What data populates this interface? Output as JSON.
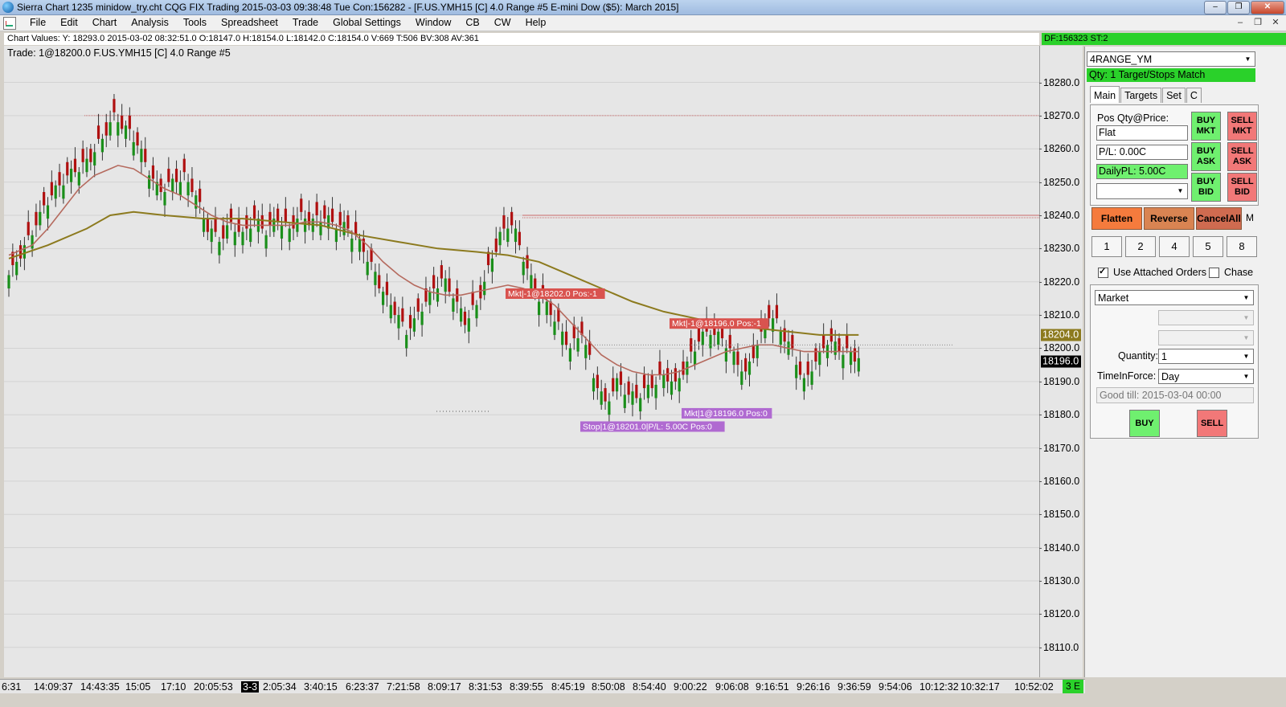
{
  "window": {
    "title": "Sierra Chart 1235 minidow_try.cht  CQG FIX Trading 2015-03-03  09:38:48 Tue   Con:156282 - [F.US.YMH15 [C]  4.0 Range  #5   E-mini Dow ($5): March 2015]",
    "minimize_glyph": "–",
    "restore_glyph": "❐",
    "close_glyph": "✕"
  },
  "menu": {
    "items": [
      "File",
      "Edit",
      "Chart",
      "Analysis",
      "Tools",
      "Spreadsheet",
      "Trade",
      "Global Settings",
      "Window",
      "CB",
      "CW",
      "Help"
    ],
    "mdi_minimize": "–",
    "mdi_restore": "❐",
    "mdi_close": "✕"
  },
  "chart": {
    "values_line": "Chart Values: Y: 18293.0  2015-03-02  08:32:51.0  O:18147.0  H:18154.0  L:18142.0  C:18154.0  V:669  T:506  BV:308  AV:361",
    "df_status": "DF:156323  ST:2",
    "trade_label": "Trade:  1@18200.0   F.US.YMH15 [C]  4.0 Range  #5",
    "current_price_badge": "18196.0",
    "ma_price_badge": "18204.0",
    "time_end_badge": "3 E",
    "colors": {
      "background": "#e6e6e6",
      "up_candle": "#1a8f1a",
      "down_candle": "#b01010",
      "ma_fast": "#b56a5e",
      "ma_slow": "#8c7a1e",
      "resistance": "#c96b6b",
      "sell_marker": "#d9534f",
      "buy_marker": "#b06ad1"
    },
    "annotations": {
      "sell1": "Mkt|-1@18202.0 Pos:-1",
      "sell2": "Mkt|-1@18196.0 Pos:-1",
      "buy1": "Mkt|1@18196.0 Pos:0",
      "stop1": "Stop|1@18201.0|P/L: 5.00C Pos:0"
    }
  },
  "chart_data": {
    "type": "candlestick",
    "title": "F.US.YMH15 [C] 4.0 Range #5",
    "ylim": [
      18101,
      18291
    ],
    "y_ticks": [
      18110,
      18120,
      18130,
      18140,
      18150,
      18160,
      18170,
      18180,
      18190,
      18200,
      18210,
      18220,
      18230,
      18240,
      18250,
      18260,
      18270,
      18280
    ],
    "x_labels": [
      "6:31",
      "14:09:37",
      "14:43:35",
      "15:05",
      "17:10",
      "20:05:53",
      "3-3",
      "2:05:34",
      "3:40:15",
      "6:23:37",
      "7:21:58",
      "8:09:17",
      "8:31:53",
      "8:39:55",
      "8:45:19",
      "8:50:08",
      "8:54:40",
      "9:00:22",
      "9:06:08",
      "9:16:51",
      "9:26:16",
      "9:36:59",
      "9:54:06",
      "10:12:32",
      "10:32:17",
      "10:52:02"
    ],
    "close_path": [
      [
        0,
        18222
      ],
      [
        4,
        18230
      ],
      [
        8,
        18240
      ],
      [
        12,
        18248
      ],
      [
        16,
        18253
      ],
      [
        20,
        18256
      ],
      [
        24,
        18263
      ],
      [
        27,
        18270
      ],
      [
        30,
        18266
      ],
      [
        33,
        18262
      ],
      [
        36,
        18253
      ],
      [
        39,
        18247
      ],
      [
        42,
        18250
      ],
      [
        45,
        18252
      ],
      [
        48,
        18246
      ],
      [
        51,
        18236
      ],
      [
        54,
        18233
      ],
      [
        57,
        18237
      ],
      [
        60,
        18234
      ],
      [
        63,
        18239
      ],
      [
        66,
        18235
      ],
      [
        69,
        18239
      ],
      [
        72,
        18236
      ],
      [
        75,
        18240
      ],
      [
        78,
        18238
      ],
      [
        81,
        18240
      ],
      [
        84,
        18237
      ],
      [
        87,
        18236
      ],
      [
        90,
        18232
      ],
      [
        93,
        18225
      ],
      [
        96,
        18217
      ],
      [
        99,
        18211
      ],
      [
        102,
        18205
      ],
      [
        105,
        18210
      ],
      [
        108,
        18216
      ],
      [
        111,
        18221
      ],
      [
        114,
        18216
      ],
      [
        117,
        18208
      ],
      [
        120,
        18213
      ],
      [
        123,
        18224
      ],
      [
        126,
        18234
      ],
      [
        129,
        18238
      ],
      [
        132,
        18227
      ],
      [
        135,
        18217
      ],
      [
        138,
        18213
      ],
      [
        141,
        18207
      ],
      [
        144,
        18200
      ],
      [
        147,
        18205
      ],
      [
        150,
        18192
      ],
      [
        153,
        18183
      ],
      [
        156,
        18190
      ],
      [
        159,
        18186
      ],
      [
        162,
        18186
      ],
      [
        165,
        18189
      ],
      [
        168,
        18192
      ],
      [
        171,
        18189
      ],
      [
        174,
        18195
      ],
      [
        177,
        18203
      ],
      [
        180,
        18205
      ],
      [
        183,
        18203
      ],
      [
        186,
        18198
      ],
      [
        189,
        18192
      ],
      [
        192,
        18201
      ],
      [
        195,
        18210
      ],
      [
        198,
        18206
      ],
      [
        201,
        18199
      ],
      [
        204,
        18190
      ],
      [
        207,
        18196
      ],
      [
        210,
        18202
      ],
      [
        213,
        18200
      ],
      [
        216,
        18198
      ],
      [
        218,
        18197
      ]
    ],
    "ma_fast": [
      [
        0,
        18228
      ],
      [
        6,
        18231
      ],
      [
        10,
        18236
      ],
      [
        14,
        18242
      ],
      [
        18,
        18248
      ],
      [
        22,
        18252
      ],
      [
        26,
        18254
      ],
      [
        28,
        18255
      ],
      [
        32,
        18254
      ],
      [
        36,
        18251
      ],
      [
        40,
        18248
      ],
      [
        44,
        18246
      ],
      [
        48,
        18243
      ],
      [
        52,
        18240
      ],
      [
        56,
        18238
      ],
      [
        60,
        18237
      ],
      [
        64,
        18237
      ],
      [
        68,
        18237
      ],
      [
        72,
        18237
      ],
      [
        76,
        18238
      ],
      [
        80,
        18238
      ],
      [
        84,
        18237
      ],
      [
        88,
        18235
      ],
      [
        92,
        18231
      ],
      [
        96,
        18226
      ],
      [
        100,
        18222
      ],
      [
        104,
        18219
      ],
      [
        108,
        18217
      ],
      [
        112,
        18216
      ],
      [
        116,
        18216
      ],
      [
        120,
        18217
      ],
      [
        124,
        18218
      ],
      [
        128,
        18219
      ],
      [
        132,
        18218
      ],
      [
        136,
        18216
      ],
      [
        140,
        18213
      ],
      [
        144,
        18208
      ],
      [
        148,
        18203
      ],
      [
        152,
        18198
      ],
      [
        156,
        18195
      ],
      [
        160,
        18193
      ],
      [
        164,
        18192
      ],
      [
        168,
        18192
      ],
      [
        172,
        18193
      ],
      [
        176,
        18195
      ],
      [
        180,
        18197
      ],
      [
        184,
        18199
      ],
      [
        188,
        18200
      ],
      [
        192,
        18201
      ],
      [
        196,
        18201
      ],
      [
        200,
        18200
      ],
      [
        204,
        18199
      ],
      [
        208,
        18199
      ],
      [
        212,
        18199
      ],
      [
        218,
        18199
      ]
    ],
    "ma_slow": [
      [
        0,
        18227
      ],
      [
        10,
        18231
      ],
      [
        20,
        18236
      ],
      [
        26,
        18240
      ],
      [
        32,
        18241
      ],
      [
        40,
        18240
      ],
      [
        50,
        18239
      ],
      [
        60,
        18239
      ],
      [
        70,
        18238
      ],
      [
        80,
        18237
      ],
      [
        90,
        18234
      ],
      [
        100,
        18232
      ],
      [
        110,
        18230
      ],
      [
        120,
        18229
      ],
      [
        128,
        18228
      ],
      [
        136,
        18226
      ],
      [
        144,
        18222
      ],
      [
        152,
        18218
      ],
      [
        160,
        18214
      ],
      [
        168,
        18211
      ],
      [
        176,
        18209
      ],
      [
        184,
        18207
      ],
      [
        192,
        18206
      ],
      [
        200,
        18205
      ],
      [
        208,
        18204
      ],
      [
        214,
        18204
      ],
      [
        218,
        18204
      ]
    ],
    "levels": [
      {
        "price": 18270.0,
        "label": ""
      },
      {
        "price": 18240.0,
        "label": ""
      }
    ]
  },
  "trade_panel": {
    "symbol_combo": "4RANGE_YM",
    "qty_bar": "Qty: 1 Target/Stops Match",
    "tabs": [
      "Main",
      "Targets",
      "Set",
      "C"
    ],
    "pos_label": "Pos Qty@Price:",
    "pos_value": "Flat",
    "pl_value": "P/L: 0.00C",
    "daily_pl": "DailyPL: 5.00C",
    "order_buttons": {
      "buy_mkt": "BUY\nMKT",
      "sell_mkt": "SELL\nMKT",
      "buy_ask": "BUY\nASK",
      "sell_ask": "SELL\nASK",
      "buy_bid": "BUY\nBID",
      "sell_bid": "SELL\nBID"
    },
    "action_buttons": [
      "Flatten",
      "Reverse",
      "CancelAll",
      "M"
    ],
    "qty_buttons": [
      "1",
      "2",
      "4",
      "5",
      "8"
    ],
    "use_attached_orders": "Use Attached Orders",
    "chase": "Chase",
    "order_type": "Market",
    "quantity_label": "Quantity:",
    "quantity_value": "1",
    "tif_label": "TimeInForce:",
    "tif_value": "Day",
    "good_till": "Good till: 2015-03-04 00:00",
    "buy_label": "BUY",
    "sell_label": "SELL"
  }
}
